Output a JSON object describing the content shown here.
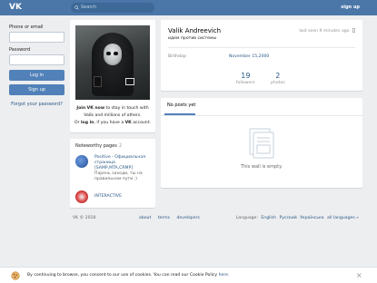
{
  "header": {
    "logo_text": "VK",
    "search_placeholder": "Search",
    "signup_label": "sign up"
  },
  "login": {
    "phone_label": "Phone or email",
    "password_label": "Password",
    "login_button": "Log in",
    "signup_button": "Sign up",
    "forgot_link": "Forgot your password?"
  },
  "photo_card": {
    "join_bold": "Join VK now",
    "join_rest": " to stay in touch with",
    "line2": "Valik and millions of others.",
    "line3_pre": "Or ",
    "line3_login": "log in",
    "line3_mid": ", if you have a ",
    "line3_vk": "VK",
    "line3_end": " account."
  },
  "noteworthy": {
    "title": "Noteworthy pages",
    "count": "2",
    "items": [
      {
        "name": "Positive - Официальная страница [SAMP,MTA,CRMP]",
        "sub": "Парень заходи, ты на правильном пути :)",
        "avatar_color": "#3f6fb6"
      },
      {
        "name": "INTERACTIVE",
        "sub": "",
        "avatar_color": "#c6343a"
      }
    ]
  },
  "profile": {
    "name": "Valik Andreevich",
    "status": "идем против системы",
    "last_seen": "last seen 9 minutes ago",
    "birthday_label": "Birthday:",
    "birthday_value": "November 15,2000"
  },
  "counters": [
    {
      "value": "19",
      "label": "followers"
    },
    {
      "value": "2",
      "label": "photos"
    }
  ],
  "wall": {
    "tab_label": "No posts yet",
    "empty_text": "This wall is empty."
  },
  "footer": {
    "copyright": "VK © 2018",
    "links": [
      "about",
      "terms",
      "developers"
    ],
    "language_label": "Language:",
    "languages": [
      "English",
      "Русский",
      "Українська",
      "all languages »"
    ]
  },
  "cookie": {
    "text": "By continuing to browse, you consent to our use of cookies. You can read our Cookie Policy ",
    "link": "here."
  },
  "colors": {
    "header_bg": "#4a76a8",
    "button_bg": "#5181b8",
    "link": "#2a5885",
    "page_bg": "#edeef0"
  }
}
